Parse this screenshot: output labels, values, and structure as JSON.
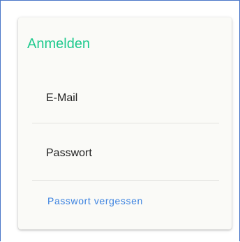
{
  "login": {
    "title": "Anmelden",
    "email_label": "E-Mail",
    "password_label": "Passwort",
    "forgot_password_link": "Passwort vergessen"
  },
  "colors": {
    "title": "#1fca8e",
    "link": "#3b82e0",
    "frame_border": "#4a76c8",
    "card_background": "#fafaf7"
  }
}
